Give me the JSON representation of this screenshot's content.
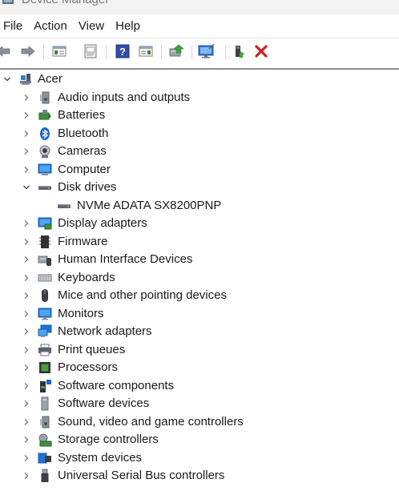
{
  "window": {
    "title": "Device Manager"
  },
  "menu": [
    "File",
    "Action",
    "View",
    "Help"
  ],
  "toolbar": {
    "buttons": [
      "back-icon",
      "forward-icon",
      "show-hide-console-tree-icon",
      "properties-icon",
      "help-icon",
      "action-pane-icon",
      "update-driver-icon",
      "scan-hardware-icon",
      "enable-device-icon",
      "uninstall-device-icon"
    ]
  },
  "tree": {
    "root": "Acer",
    "categories": [
      {
        "label": "Audio inputs and outputs",
        "icon": "speaker-icon"
      },
      {
        "label": "Batteries",
        "icon": "battery-icon"
      },
      {
        "label": "Bluetooth",
        "icon": "bluetooth-icon"
      },
      {
        "label": "Cameras",
        "icon": "camera-icon"
      },
      {
        "label": "Computer",
        "icon": "computer-icon"
      },
      {
        "label": "Disk drives",
        "icon": "disk-drive-icon",
        "expanded": true
      },
      {
        "label": "NVMe ADATA SX8200PNP",
        "icon": "disk-drive-icon",
        "child": true
      },
      {
        "label": "Display adapters",
        "icon": "display-adapter-icon"
      },
      {
        "label": "Firmware",
        "icon": "firmware-icon"
      },
      {
        "label": "Human Interface Devices",
        "icon": "hid-icon"
      },
      {
        "label": "Keyboards",
        "icon": "keyboard-icon"
      },
      {
        "label": "Mice and other pointing devices",
        "icon": "mouse-icon"
      },
      {
        "label": "Monitors",
        "icon": "monitor-icon"
      },
      {
        "label": "Network adapters",
        "icon": "network-adapter-icon"
      },
      {
        "label": "Print queues",
        "icon": "printer-icon"
      },
      {
        "label": "Processors",
        "icon": "processor-icon"
      },
      {
        "label": "Software components",
        "icon": "software-component-icon"
      },
      {
        "label": "Software devices",
        "icon": "software-device-icon"
      },
      {
        "label": "Sound, video and game controllers",
        "icon": "speaker-icon"
      },
      {
        "label": "Storage controllers",
        "icon": "storage-controller-icon"
      },
      {
        "label": "System devices",
        "icon": "system-devices-icon"
      },
      {
        "label": "Universal Serial Bus controllers",
        "icon": "usb-icon"
      }
    ]
  }
}
